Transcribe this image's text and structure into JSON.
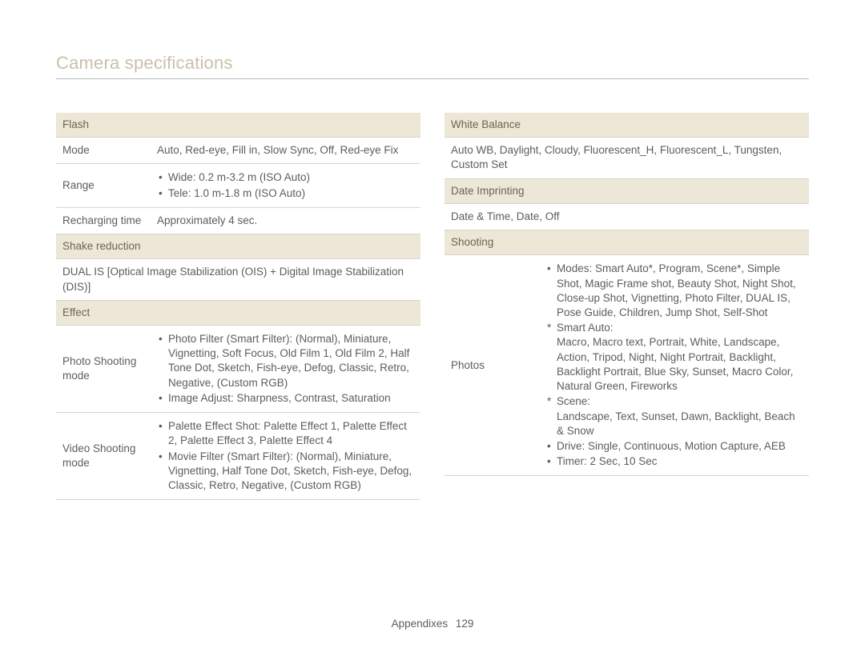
{
  "page_title": "Camera specifications",
  "footer": {
    "section": "Appendixes",
    "page_number": "129"
  },
  "left": {
    "flash": {
      "header": "Flash",
      "mode_label": "Mode",
      "mode_value": "Auto, Red-eye, Fill in, Slow Sync, Off, Red-eye Fix",
      "range_label": "Range",
      "range_bullets": [
        "Wide: 0.2 m-3.2 m (ISO Auto)",
        "Tele: 1.0 m-1.8 m (ISO Auto)"
      ],
      "recharge_label": "Recharging time",
      "recharge_value": "Approximately 4 sec."
    },
    "shake": {
      "header": "Shake reduction",
      "value": "DUAL IS [Optical Image Stabilization (OIS) + Digital Image Stabilization (DIS)]"
    },
    "effect": {
      "header": "Effect",
      "photo_label": "Photo Shooting mode",
      "photo_bullets": [
        "Photo Filter (Smart Filter): (Normal), Miniature, Vignetting, Soft Focus, Old Film 1, Old Film 2, Half Tone Dot, Sketch, Fish-eye, Defog, Classic, Retro, Negative, (Custom RGB)",
        "Image Adjust: Sharpness, Contrast, Saturation"
      ],
      "video_label": "Video Shooting mode",
      "video_bullets": [
        "Palette Effect Shot: Palette Effect 1, Palette Effect 2, Palette Effect 3, Palette Effect 4",
        "Movie Filter (Smart Filter): (Normal), Miniature, Vignetting, Half Tone Dot, Sketch, Fish-eye, Defog, Classic, Retro, Negative, (Custom RGB)"
      ]
    }
  },
  "right": {
    "wb": {
      "header": "White Balance",
      "value": "Auto WB, Daylight, Cloudy, Fluorescent_H, Fluorescent_L, Tungsten, Custom Set"
    },
    "date": {
      "header": "Date Imprinting",
      "value": "Date & Time, Date, Off"
    },
    "shooting": {
      "header": "Shooting",
      "photos_label": "Photos",
      "modes_bullet": "Modes: Smart Auto*, Program, Scene*, Simple Shot, Magic Frame shot, Beauty Shot, Night Shot, Close-up Shot, Vignetting, Photo Filter, DUAL IS, Pose Guide, Children, Jump Shot, Self-Shot",
      "smart_auto_label": "Smart Auto:",
      "smart_auto_text": "Macro, Macro text, Portrait, White, Landscape, Action, Tripod, Night, Night Portrait, Backlight, Backlight Portrait, Blue Sky, Sunset, Macro Color, Natural Green, Fireworks",
      "scene_label": "Scene:",
      "scene_text": "Landscape, Text, Sunset, Dawn, Backlight, Beach & Snow",
      "drive_bullet": "Drive: Single, Continuous, Motion Capture, AEB",
      "timer_bullet": "Timer: 2 Sec, 10 Sec"
    }
  }
}
